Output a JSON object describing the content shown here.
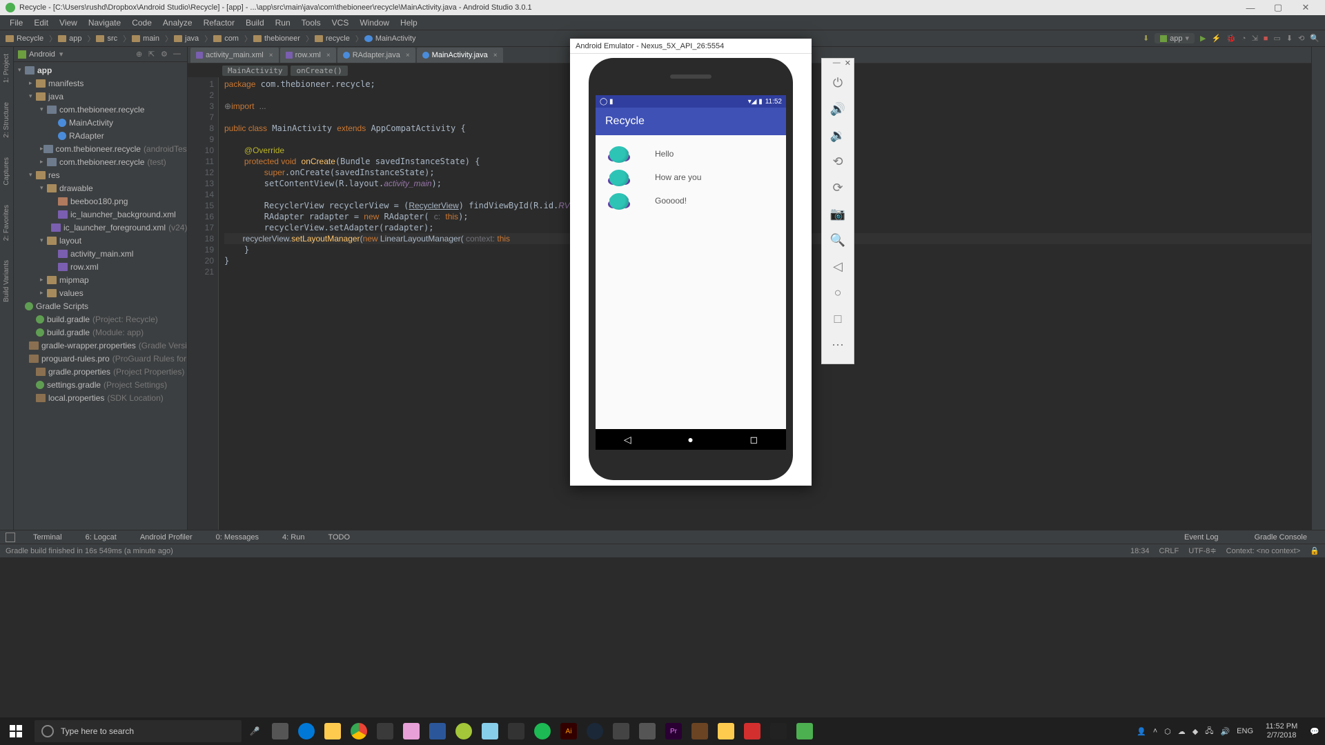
{
  "window": {
    "title": "Recycle - [C:\\Users\\rushd\\Dropbox\\Android Studio\\Recycle] - [app] - ...\\app\\src\\main\\java\\com\\thebioneer\\recycle\\MainActivity.java - Android Studio 3.0.1"
  },
  "menu": [
    "File",
    "Edit",
    "View",
    "Navigate",
    "Code",
    "Analyze",
    "Refactor",
    "Build",
    "Run",
    "Tools",
    "VCS",
    "Window",
    "Help"
  ],
  "breadcrumbs": [
    "Recycle",
    "app",
    "src",
    "main",
    "java",
    "com",
    "thebioneer",
    "recycle",
    "MainActivity"
  ],
  "runConfig": "app",
  "leftTabs": [
    "1: Project",
    "2: Structure",
    "Captures",
    "2: Favorites",
    "Build Variants"
  ],
  "projectPanel": {
    "mode": "Android"
  },
  "tree": [
    {
      "d": 0,
      "a": "v",
      "i": "pkg",
      "t": "app",
      "bold": true
    },
    {
      "d": 1,
      "a": ">",
      "i": "fld",
      "t": "manifests"
    },
    {
      "d": 1,
      "a": "v",
      "i": "fld",
      "t": "java"
    },
    {
      "d": 2,
      "a": "v",
      "i": "pkg",
      "t": "com.thebioneer.recycle"
    },
    {
      "d": 3,
      "a": "",
      "i": "cls",
      "t": "MainActivity"
    },
    {
      "d": 3,
      "a": "",
      "i": "cls",
      "t": "RAdapter"
    },
    {
      "d": 2,
      "a": ">",
      "i": "pkg",
      "t": "com.thebioneer.recycle",
      "dim": "(androidTest)"
    },
    {
      "d": 2,
      "a": ">",
      "i": "pkg",
      "t": "com.thebioneer.recycle",
      "dim": "(test)"
    },
    {
      "d": 1,
      "a": "v",
      "i": "fld",
      "t": "res"
    },
    {
      "d": 2,
      "a": "v",
      "i": "fld",
      "t": "drawable"
    },
    {
      "d": 3,
      "a": "",
      "i": "png",
      "t": "beeboo180.png"
    },
    {
      "d": 3,
      "a": "",
      "i": "xml",
      "t": "ic_launcher_background.xml"
    },
    {
      "d": 3,
      "a": "",
      "i": "xml",
      "t": "ic_launcher_foreground.xml",
      "dim": "(v24)"
    },
    {
      "d": 2,
      "a": "v",
      "i": "fld",
      "t": "layout"
    },
    {
      "d": 3,
      "a": "",
      "i": "xml",
      "t": "activity_main.xml"
    },
    {
      "d": 3,
      "a": "",
      "i": "xml",
      "t": "row.xml"
    },
    {
      "d": 2,
      "a": ">",
      "i": "fld",
      "t": "mipmap"
    },
    {
      "d": 2,
      "a": ">",
      "i": "fld",
      "t": "values"
    },
    {
      "d": 0,
      "a": "",
      "i": "gradle",
      "t": "Gradle Scripts"
    },
    {
      "d": 1,
      "a": "",
      "i": "gradle",
      "t": "build.gradle",
      "dim": "(Project: Recycle)"
    },
    {
      "d": 1,
      "a": "",
      "i": "gradle",
      "t": "build.gradle",
      "dim": "(Module: app)"
    },
    {
      "d": 1,
      "a": "",
      "i": "prop",
      "t": "gradle-wrapper.properties",
      "dim": "(Gradle Version)"
    },
    {
      "d": 1,
      "a": "",
      "i": "prop",
      "t": "proguard-rules.pro",
      "dim": "(ProGuard Rules for app)"
    },
    {
      "d": 1,
      "a": "",
      "i": "prop",
      "t": "gradle.properties",
      "dim": "(Project Properties)"
    },
    {
      "d": 1,
      "a": "",
      "i": "gradle",
      "t": "settings.gradle",
      "dim": "(Project Settings)"
    },
    {
      "d": 1,
      "a": "",
      "i": "prop",
      "t": "local.properties",
      "dim": "(SDK Location)"
    }
  ],
  "editorTabs": [
    {
      "name": "activity_main.xml",
      "icon": "xml"
    },
    {
      "name": "row.xml",
      "icon": "xml"
    },
    {
      "name": "RAdapter.java",
      "icon": "cls"
    },
    {
      "name": "MainActivity.java",
      "icon": "cls",
      "active": true
    }
  ],
  "editorCrumbs": [
    "MainActivity",
    "onCreate()"
  ],
  "lineNumbers": [
    "1",
    "2",
    "3",
    "7",
    "8",
    "9",
    "10",
    "11",
    "12",
    "13",
    "14",
    "15",
    "16",
    "17",
    "18",
    "19",
    "20",
    "21"
  ],
  "code": {
    "l1": "package com.thebioneer.recycle;",
    "l3": "import ...",
    "l8": "public class MainActivity extends AppCompatActivity {",
    "l10": "    @Override",
    "l11": "    protected void onCreate(Bundle savedInstanceState) {",
    "l12": "        super.onCreate(savedInstanceState);",
    "l13": "        setContentView(R.layout.activity_main);",
    "l15": "        RecyclerView recyclerView = (RecyclerView) findViewById(R.id.RVie",
    "l16": "        RAdapter radapter = new RAdapter( c: this);",
    "l17": "        recyclerView.setAdapter(radapter);",
    "l18": "        recyclerView.setLayoutManager(new LinearLayoutManager( context: this",
    "l19": "    }",
    "l20": "}"
  },
  "bottomTabs": [
    "Terminal",
    "6: Logcat",
    "Android Profiler",
    "0: Messages",
    "4: Run",
    "TODO"
  ],
  "bottomRight": [
    "Event Log",
    "Gradle Console"
  ],
  "statusMsg": "Gradle build finished in 16s 549ms (a minute ago)",
  "statusRight": {
    "pos": "18:34",
    "lf": "CRLF",
    "enc": "UTF-8",
    "ctx": "Context: <no context>"
  },
  "emulator": {
    "title": "Android Emulator - Nexus_5X_API_26:5554",
    "time": "11:52",
    "appTitle": "Recycle",
    "rows": [
      "Hello",
      "How are you",
      "Gooood!"
    ]
  },
  "taskbar": {
    "searchPlaceholder": "Type here to search",
    "lang": "ENG",
    "time": "11:52 PM",
    "date": "2/7/2018"
  }
}
